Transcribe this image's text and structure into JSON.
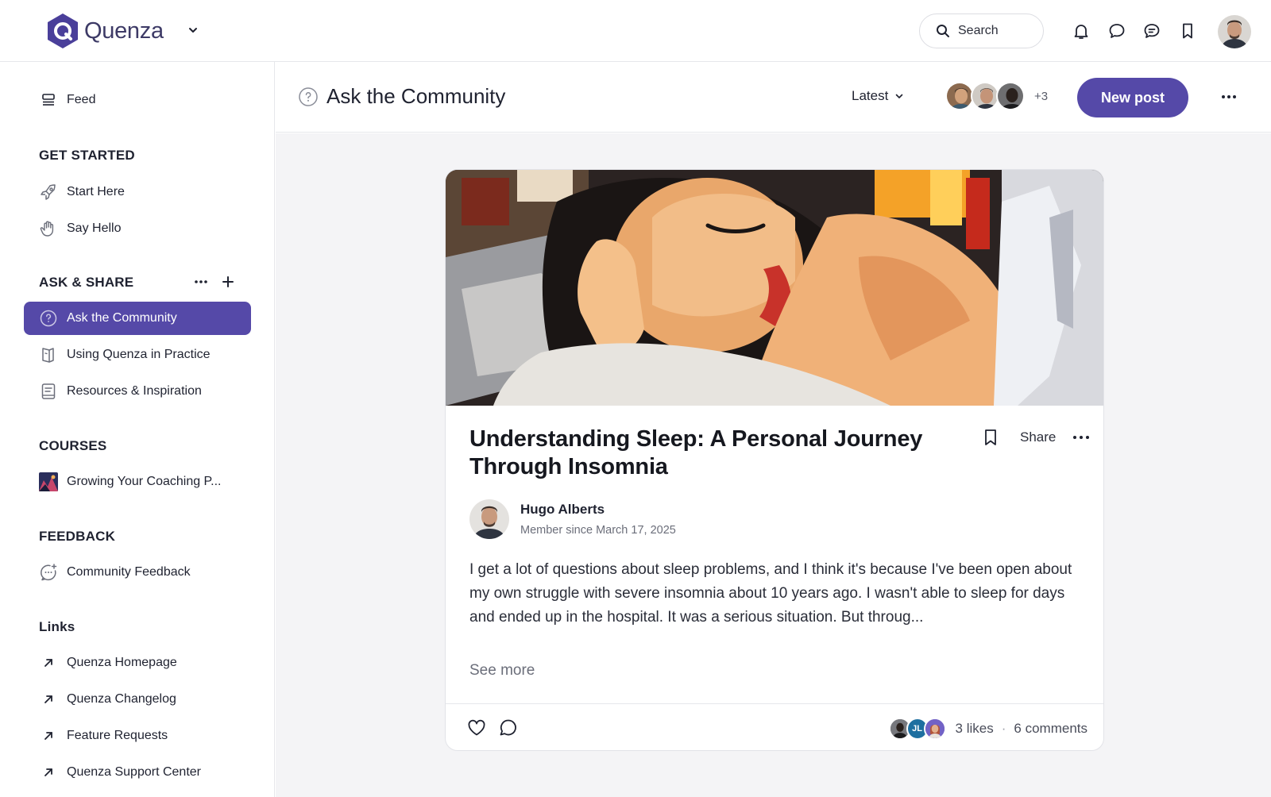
{
  "app": {
    "brand": "Quenza",
    "search_label": "Search"
  },
  "sidebar": {
    "feed_label": "Feed",
    "sections": {
      "get_started": "GET STARTED",
      "ask_share": "ASK & SHARE",
      "courses": "COURSES",
      "feedback": "FEEDBACK",
      "links": "Links"
    },
    "items": {
      "start_here": "Start Here",
      "say_hello": "Say Hello",
      "ask_community": "Ask the Community",
      "using_quenza": "Using Quenza in Practice",
      "resources": "Resources & Inspiration",
      "growing": "Growing Your Coaching P...",
      "community_feedback": "Community Feedback",
      "homepage": "Quenza Homepage",
      "changelog": "Quenza Changelog",
      "feature_requests": "Feature Requests",
      "support": "Quenza Support Center"
    }
  },
  "header": {
    "title": "Ask the Community",
    "sort_label": "Latest",
    "members_more": "+3",
    "new_post_label": "New post"
  },
  "post": {
    "title": "Understanding Sleep: A Personal Journey Through Insomnia",
    "share_label": "Share",
    "author_name": "Hugo Alberts",
    "author_sub": "Member since March 17, 2025",
    "body": "I get a lot of questions about sleep problems, and I think it's because I've been open about my own struggle with severe insomnia about 10 years ago. I wasn't able to sleep for days and ended up in the hospital. It was a serious situation. But throug...",
    "see_more": "See more",
    "liker_initials": "JL",
    "likes": "3 likes",
    "separator": "·",
    "comments": "6 comments"
  },
  "colors": {
    "accent": "#5549a8",
    "logo": "#4a3f9a"
  }
}
